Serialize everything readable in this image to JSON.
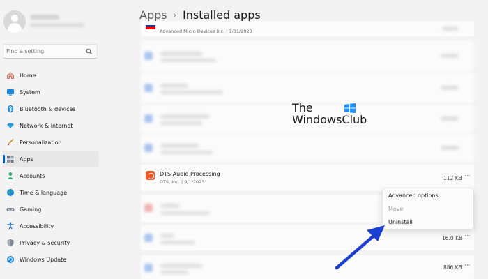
{
  "search": {
    "placeholder": "Find a setting"
  },
  "nav": [
    {
      "label": "Home",
      "icon": "home-icon"
    },
    {
      "label": "System",
      "icon": "system-icon"
    },
    {
      "label": "Bluetooth & devices",
      "icon": "bluetooth-icon"
    },
    {
      "label": "Network & internet",
      "icon": "wifi-icon"
    },
    {
      "label": "Personalization",
      "icon": "brush-icon"
    },
    {
      "label": "Apps",
      "icon": "apps-icon",
      "active": true
    },
    {
      "label": "Accounts",
      "icon": "person-icon"
    },
    {
      "label": "Time & language",
      "icon": "globe-icon"
    },
    {
      "label": "Gaming",
      "icon": "gamepad-icon"
    },
    {
      "label": "Accessibility",
      "icon": "accessibility-icon"
    },
    {
      "label": "Privacy & security",
      "icon": "shield-icon"
    },
    {
      "label": "Windows Update",
      "icon": "update-icon"
    }
  ],
  "breadcrumb": {
    "parent": "Apps",
    "separator": "›",
    "current": "Installed apps"
  },
  "apps": {
    "amd": {
      "publisher_date": "Advanced Micro Devices Inc.  |  7/31/2023"
    },
    "dts": {
      "name": "DTS Audio Processing",
      "publisher_date": "DTS, Inc.  |  9/1/2023",
      "size": "112 KB"
    },
    "row_a": {
      "size": "16.0 KB"
    },
    "row_b": {
      "size": "886 KB"
    },
    "more_label": "···"
  },
  "context_menu": {
    "advanced": "Advanced options",
    "move": "Move",
    "uninstall": "Uninstall"
  },
  "watermark": {
    "line1": "The",
    "line2": "WindowsClub"
  },
  "colors": {
    "accent": "#005fb8",
    "arrow": "#1a3fd1"
  }
}
